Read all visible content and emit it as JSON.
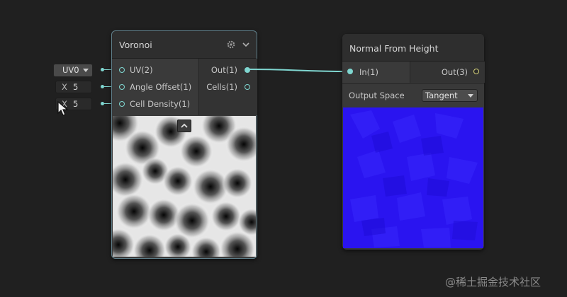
{
  "voronoi": {
    "title": "Voronoi",
    "inputs": [
      "UV(2)",
      "Angle Offset(1)",
      "Cell Density(1)"
    ],
    "outputs": [
      "Out(1)",
      "Cells(1)"
    ]
  },
  "inline_inputs": {
    "uv_value": "UV0",
    "angle_label": "X",
    "angle_value": "5",
    "density_label": "X",
    "density_value": "5"
  },
  "normal_node": {
    "title": "Normal From Height",
    "input": "In(1)",
    "output": "Out(3)",
    "output_space_label": "Output Space",
    "output_space_value": "Tangent"
  },
  "watermark": "@稀土掘金技术社区",
  "colors": {
    "background": "#202020",
    "node_body": "#393939",
    "node_header": "#2e2e2e",
    "port_cyan": "#7fd6d0",
    "port_yellow": "#d6d27a",
    "normal_preview": "#2a14f0"
  },
  "icons": [
    "gear-icon",
    "chevron-down-icon",
    "collapse-up-icon",
    "cursor-icon"
  ]
}
